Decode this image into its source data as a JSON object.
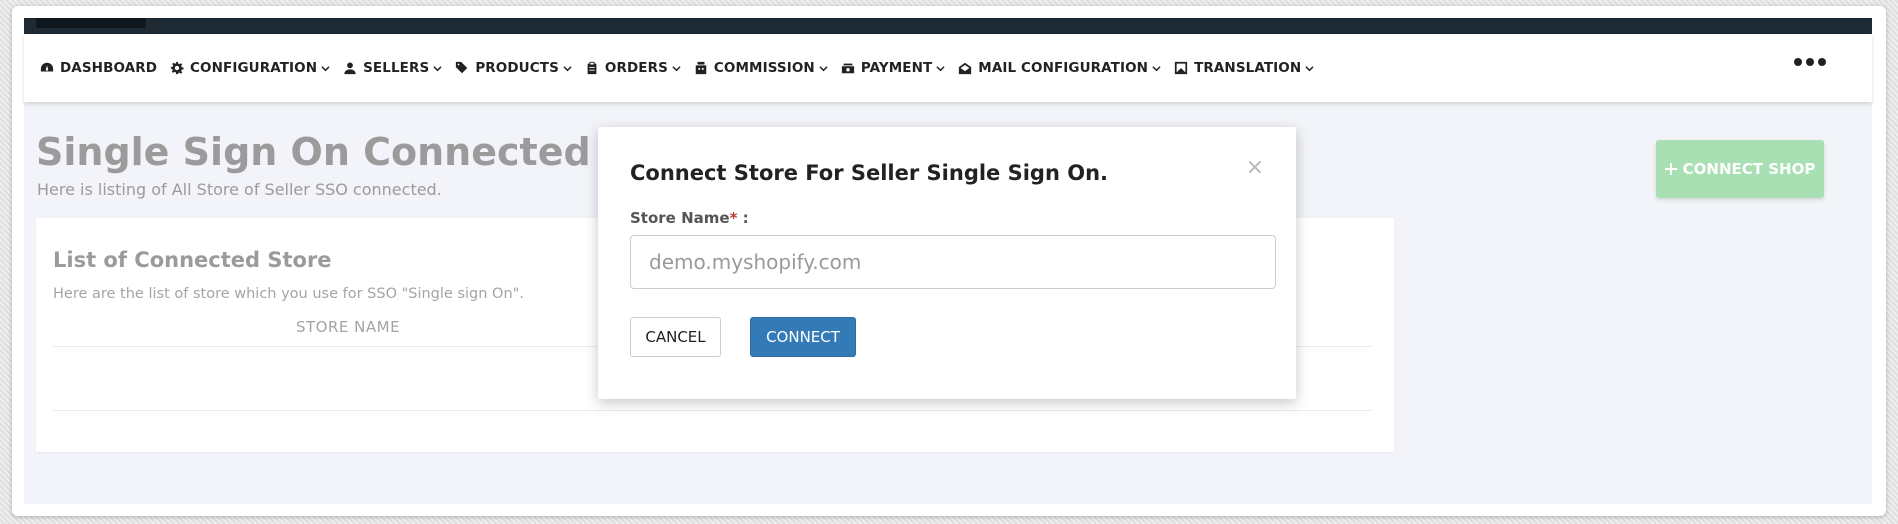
{
  "nav": {
    "items": [
      {
        "label": "DASHBOARD",
        "icon": "dashboard-icon",
        "dropdown": false
      },
      {
        "label": "CONFIGURATION",
        "icon": "gear-icon",
        "dropdown": true
      },
      {
        "label": "SELLERS",
        "icon": "user-icon",
        "dropdown": true
      },
      {
        "label": "PRODUCTS",
        "icon": "tags-icon",
        "dropdown": true
      },
      {
        "label": "ORDERS",
        "icon": "clipboard-icon",
        "dropdown": true
      },
      {
        "label": "COMMISSION",
        "icon": "register-icon",
        "dropdown": true
      },
      {
        "label": "PAYMENT",
        "icon": "money-icon",
        "dropdown": true
      },
      {
        "label": "MAIL CONFIGURATION",
        "icon": "envelope-open-icon",
        "dropdown": true
      },
      {
        "label": "TRANSLATION",
        "icon": "language-icon",
        "dropdown": true
      }
    ],
    "more_icon": "ellipsis-icon"
  },
  "page": {
    "title": "Single Sign On Connected Store",
    "subtitle": "Here is listing of All Store of Seller SSO connected.",
    "connect_shop_label": "CONNECT SHOP",
    "connect_shop_icon": "plus-icon"
  },
  "card": {
    "title": "List of Connected Store",
    "description": "Here are the list of store which you use for SSO \"Single sign On\".",
    "column_header": "STORE NAME"
  },
  "modal": {
    "title": "Connect Store For Seller Single Sign On.",
    "close_glyph": "×",
    "field_label": "Store Name",
    "required_mark": "*",
    "field_suffix": " :",
    "input_value": "",
    "input_placeholder": "demo.myshopify.com",
    "cancel_label": "CANCEL",
    "connect_label": "CONNECT"
  },
  "colors": {
    "nav_dark": "#1d2a33",
    "primary": "#337ab7",
    "success_light": "#a8e0b4",
    "required": "#c0392b"
  }
}
